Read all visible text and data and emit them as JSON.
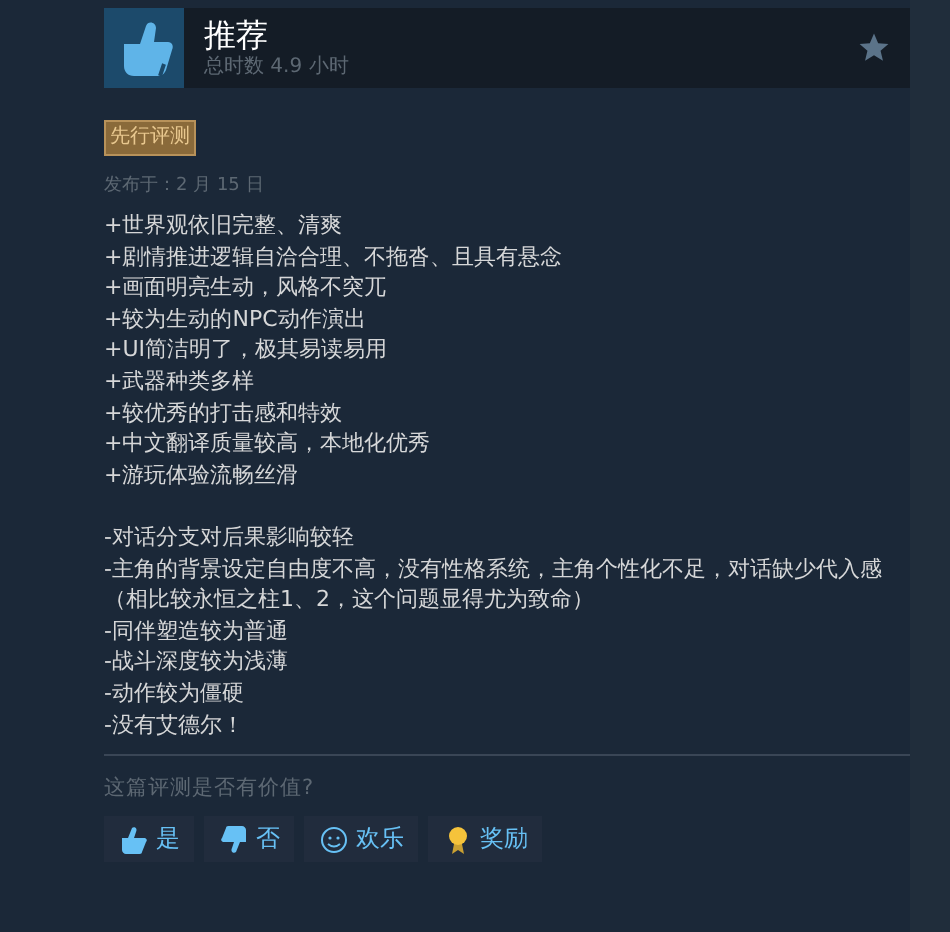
{
  "review": {
    "verdict": "推荐",
    "playtime": "总时数 4.9 小时",
    "badge": "先行评测",
    "posted": "发布于：2 月 15 日",
    "pros": [
      "+世界观依旧完整、清爽",
      "+剧情推进逻辑自洽合理、不拖沓、且具有悬念",
      "+画面明亮生动，风格不突兀",
      "+较为生动的NPC动作演出",
      "+UI简洁明了，极其易读易用",
      "+武器种类多样",
      "+较优秀的打击感和特效",
      "+中文翻译质量较高，本地化优秀",
      "+游玩体验流畅丝滑"
    ],
    "cons": [
      "-对话分支对后果影响较轻",
      "-主角的背景设定自由度不高，没有性格系统，主角个性化不足，对话缺少代入感（相比较永恒之柱1、2，这个问题显得尤为致命）",
      "-同伴塑造较为普通",
      "-战斗深度较为浅薄",
      "-动作较为僵硬",
      "-没有艾德尔！"
    ]
  },
  "feedback": {
    "question": "这篇评测是否有价值?",
    "buttons": [
      {
        "kind": "yes",
        "label": "是"
      },
      {
        "kind": "no",
        "label": "否"
      },
      {
        "kind": "funny",
        "label": "欢乐"
      },
      {
        "kind": "award",
        "label": "奖励"
      }
    ]
  }
}
